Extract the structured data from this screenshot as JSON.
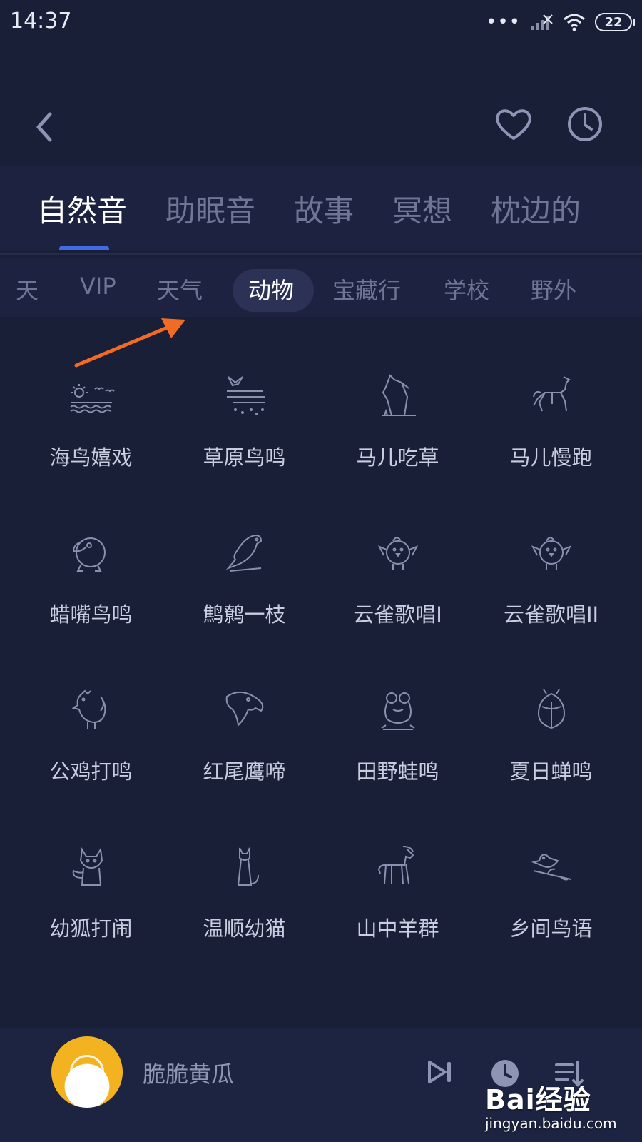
{
  "status": {
    "time": "14:37",
    "battery": "22",
    "icons": [
      "more-dots-icon",
      "signal-icon",
      "wifi-icon",
      "battery-icon"
    ]
  },
  "header": {
    "icons": [
      "back-arrow-icon",
      "heart-icon",
      "clock-icon"
    ]
  },
  "main_tabs": [
    {
      "label": "自然音",
      "active": true
    },
    {
      "label": "助眠音",
      "active": false
    },
    {
      "label": "故事",
      "active": false
    },
    {
      "label": "冥想",
      "active": false
    },
    {
      "label": "枕边的",
      "active": false
    }
  ],
  "sub_tabs": [
    {
      "label": "天",
      "active": false
    },
    {
      "label": "VIP",
      "active": false
    },
    {
      "label": "天气",
      "active": false
    },
    {
      "label": "动物",
      "active": true
    },
    {
      "label": "宝藏行",
      "active": false
    },
    {
      "label": "学校",
      "active": false
    },
    {
      "label": "野外",
      "active": false
    }
  ],
  "sounds": [
    {
      "label": "海鸟嬉戏",
      "icon": "seabird-icon"
    },
    {
      "label": "草原鸟鸣",
      "icon": "prairie-bird-icon"
    },
    {
      "label": "马儿吃草",
      "icon": "horse-grazing-icon"
    },
    {
      "label": "马儿慢跑",
      "icon": "horse-running-icon"
    },
    {
      "label": "蜡嘴鸟鸣",
      "icon": "toucan-icon"
    },
    {
      "label": "鹪鹩一枝",
      "icon": "wren-icon"
    },
    {
      "label": "云雀歌唱I",
      "icon": "skylark-icon"
    },
    {
      "label": "云雀歌唱II",
      "icon": "skylark-icon"
    },
    {
      "label": "公鸡打鸣",
      "icon": "rooster-icon"
    },
    {
      "label": "红尾鹰啼",
      "icon": "eagle-icon"
    },
    {
      "label": "田野蛙鸣",
      "icon": "frog-icon"
    },
    {
      "label": "夏日蝉鸣",
      "icon": "cicada-icon"
    },
    {
      "label": "幼狐打闹",
      "icon": "fox-icon"
    },
    {
      "label": "温顺幼猫",
      "icon": "cat-icon"
    },
    {
      "label": "山中羊群",
      "icon": "goat-icon"
    },
    {
      "label": "乡间鸟语",
      "icon": "bird-branch-icon"
    }
  ],
  "player": {
    "title": "脆脆黄瓜",
    "icons": [
      "play-icon",
      "next-track-icon",
      "timer-icon",
      "playlist-icon"
    ]
  },
  "annotation": {
    "color": "#f26b24"
  },
  "watermark": {
    "brand": "Bai经验",
    "url": "jingyan.baidu.com"
  },
  "colors": {
    "background": "#1a1f38",
    "accent": "#3f6ce6",
    "inactive_text": "#6f7594",
    "active_text": "#ffffff"
  }
}
